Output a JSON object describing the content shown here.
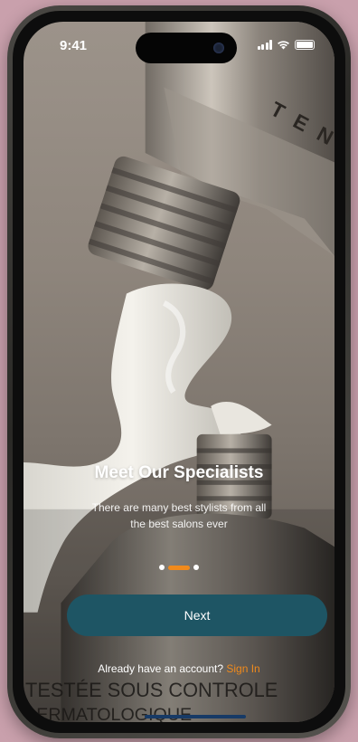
{
  "status_bar": {
    "time": "9:41",
    "icons": [
      "signal-icon",
      "wifi-icon",
      "battery-icon"
    ]
  },
  "background": {
    "tube_lettering_top": "TEN",
    "tube_lettering_bottom": [
      "TESTÉE SOUS CONTROLE",
      "DERMATOLOGIQUE"
    ]
  },
  "onboarding": {
    "title": "Meet Our Specialists",
    "subtitle": "There are many best stylists from all the best salons ever",
    "page_indicator": {
      "total": 3,
      "active_index": 1
    }
  },
  "actions": {
    "next_label": "Next",
    "account_prompt": "Already have an account?",
    "sign_in_label": "Sign In"
  },
  "colors": {
    "accent": "#f08a1c",
    "button": "#1e5564",
    "backdrop": "#c9a0ac"
  }
}
